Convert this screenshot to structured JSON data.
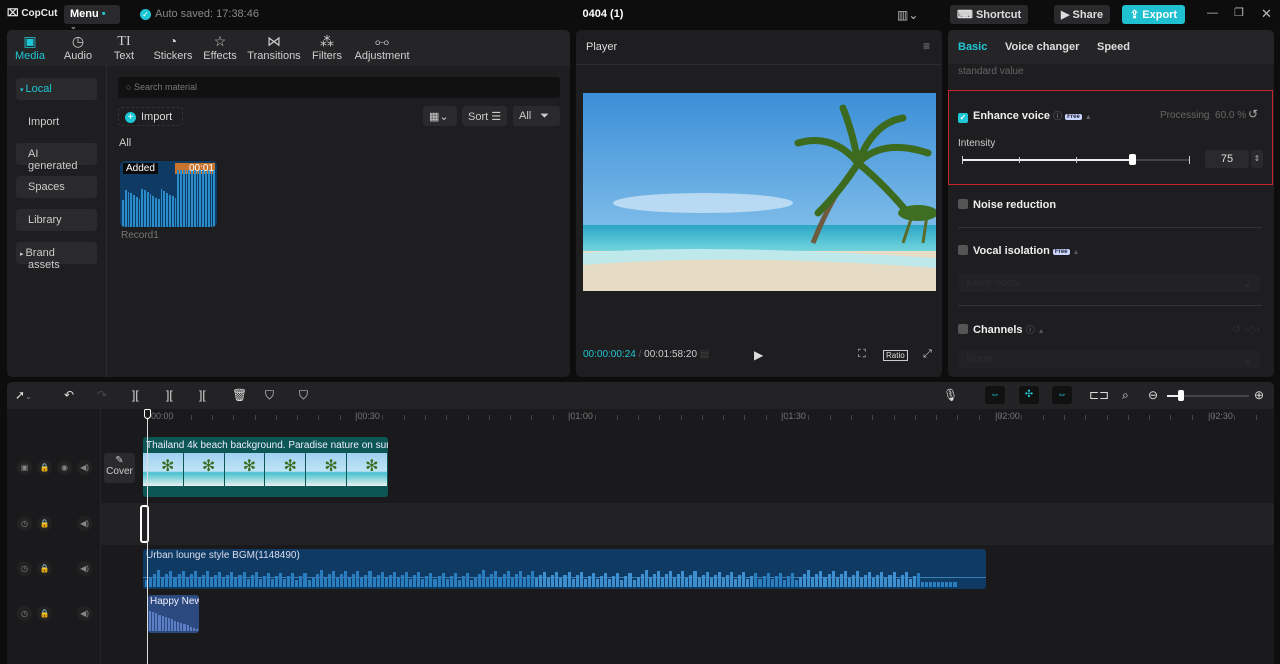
{
  "app": {
    "logo": "CopCut",
    "menu_label": "Menu",
    "autosave": "Auto saved: 17:38:46",
    "project_title": "0404 (1)"
  },
  "header_buttons": {
    "shortcut": "Shortcut",
    "share": "Share",
    "export": "Export"
  },
  "media_panel": {
    "tabs": [
      {
        "label": "Media",
        "icon": "media-icon",
        "glyph": "▣"
      },
      {
        "label": "Audio",
        "icon": "audio-icon",
        "glyph": "◷"
      },
      {
        "label": "Text",
        "icon": "text-icon",
        "glyph": "TI"
      },
      {
        "label": "Stickers",
        "icon": "sticker-icon",
        "glyph": "◔"
      },
      {
        "label": "Effects",
        "icon": "effects-icon",
        "glyph": "☆"
      },
      {
        "label": "Transitions",
        "icon": "transitions-icon",
        "glyph": "⋈"
      },
      {
        "label": "Filters",
        "icon": "filters-icon",
        "glyph": "⁂"
      },
      {
        "label": "Adjustment",
        "icon": "adjustment-icon",
        "glyph": "⧟"
      }
    ],
    "sidebar": [
      "Local",
      "Import",
      "AI generated",
      "Spaces",
      "Library",
      "Brand assets"
    ],
    "search_placeholder": "Search material",
    "import_label": "Import",
    "sort_label": "Sort",
    "filter_label": "All",
    "section_label": "All",
    "item": {
      "badge": "Added",
      "duration": "00:01",
      "name": "Record1"
    }
  },
  "player": {
    "title": "Player",
    "current_time": "00:00:00:24",
    "total_time": "00:01:58:20",
    "ratio_label": "Ratio"
  },
  "properties": {
    "tabs": [
      "Basic",
      "Voice changer",
      "Speed"
    ],
    "standard_value": "standard value",
    "enhance_voice": {
      "label": "Enhance voice",
      "checked": true,
      "badge": "Free",
      "status": "Processing",
      "progress": "60.0 %",
      "intensity_label": "Intensity",
      "intensity": 75
    },
    "noise_reduction": {
      "label": "Noise reduction",
      "checked": false
    },
    "vocal_isolation": {
      "label": "Vocal isolation",
      "checked": false,
      "badge": "Free",
      "option": "Keep vocal"
    },
    "channels": {
      "label": "Channels",
      "checked": false,
      "option": "None"
    },
    "highlight_color": "#c8252c",
    "accent_color": "#1fc7d4"
  },
  "timeline": {
    "ruler": [
      "00:00",
      "|00:30",
      "|01:00",
      "|01:30",
      "|02:00",
      "|02:30"
    ],
    "cover_label": "Cover",
    "clips": {
      "video": "Thailand 4k beach background. Paradise nature on sun",
      "bgm": "Urban lounge style BGM(1148490)",
      "voice": "Happy New"
    }
  }
}
